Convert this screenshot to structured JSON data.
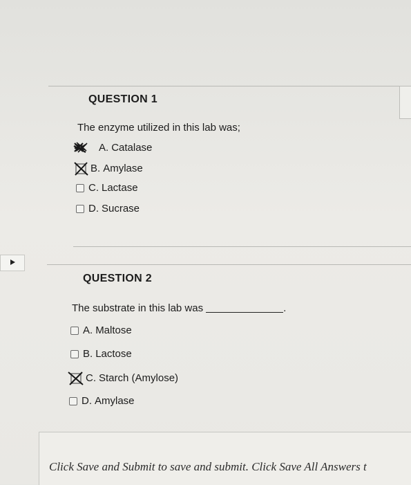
{
  "questions": [
    {
      "title": "QUESTION 1",
      "text": "The enzyme utilized in this lab was;",
      "options": [
        {
          "letter": "A.",
          "label": "Catalase",
          "mark": "scribble"
        },
        {
          "letter": "B.",
          "label": "Amylase",
          "mark": "x"
        },
        {
          "letter": "C.",
          "label": "Lactase",
          "mark": "none"
        },
        {
          "letter": "D.",
          "label": "Sucrase",
          "mark": "none"
        }
      ]
    },
    {
      "title": "QUESTION 2",
      "text": "The substrate in this lab was",
      "options": [
        {
          "letter": "A.",
          "label": "Maltose",
          "mark": "none"
        },
        {
          "letter": "B.",
          "label": "Lactose",
          "mark": "none"
        },
        {
          "letter": "C.",
          "label": "Starch (Amylose)",
          "mark": "x"
        },
        {
          "letter": "D.",
          "label": "Amylase",
          "mark": "none"
        }
      ]
    }
  ],
  "footer": {
    "text": "Click Save and Submit to save and submit. Click Save All Answers t"
  },
  "icons": {
    "nav_arrow": "play-triangle-icon"
  },
  "colors": {
    "background": "#e6e6e2",
    "text": "#1c1c1c",
    "checkbox_border": "#6a6a6a"
  }
}
